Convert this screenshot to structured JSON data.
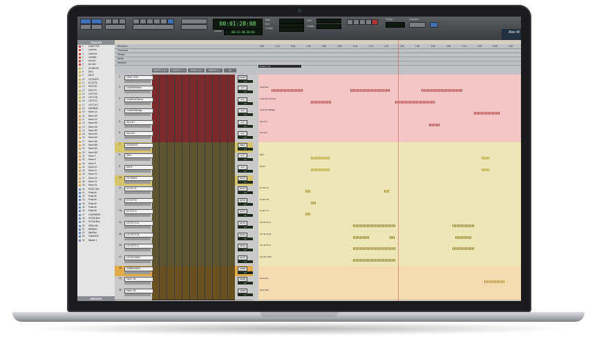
{
  "toolbar": {
    "main_counter": "00:01:28:08",
    "secondary_counter": "00:31:38:20:01",
    "start_label": "Start",
    "end_label": "End",
    "length_label": "Length",
    "nudge_label": "Nudge",
    "tempo_label": "Tempo",
    "quantize_label": "Quantize",
    "cursor_label": "Cursor",
    "grid_label": "Grid",
    "user_name": "Alex W"
  },
  "sidebar": {
    "tracks_header": "TRACKS",
    "groups_header": "GROUPS",
    "items": [
      {
        "num": "1",
        "name": "LEAD VOX",
        "color": "#d24040"
      },
      {
        "num": "2",
        "name": "LdVoVrs",
        "color": "#d24040"
      },
      {
        "num": "3",
        "name": "LdVoChr",
        "color": "#d24040"
      },
      {
        "num": "4",
        "name": "LdVdBri",
        "color": "#d24040"
      },
      {
        "num": "5",
        "name": "Ad Lib1",
        "color": "#d24040"
      },
      {
        "num": "6",
        "name": "Ad Lib2",
        "color": "#d24040"
      },
      {
        "num": "7",
        "name": "DOUBLES",
        "color": "#c8b442"
      },
      {
        "num": "8",
        "name": "Dbl L",
        "color": "#c8b442"
      },
      {
        "num": "9",
        "name": "Dbl R",
        "color": "#c8b442"
      },
      {
        "num": "10",
        "name": "OCTAVES",
        "color": "#c8b442"
      },
      {
        "num": "11",
        "name": "HI OCTA",
        "color": "#c8b442"
      },
      {
        "num": "12",
        "name": "HIOCTB",
        "color": "#c8b442"
      },
      {
        "num": "13",
        "name": "HIOCTC",
        "color": "#c8b442"
      },
      {
        "num": "14",
        "name": "LOCTVA",
        "color": "#c8b442"
      },
      {
        "num": "15",
        "name": "LOCTVB",
        "color": "#c8b442"
      },
      {
        "num": "16",
        "name": "LOCTVC",
        "color": "#c8b442"
      },
      {
        "num": "17",
        "name": "LOCTVLT",
        "color": "#c8b442"
      },
      {
        "num": "18",
        "name": "HARMNS",
        "color": "#e0a040"
      },
      {
        "num": "19",
        "name": "Harm 1A",
        "color": "#e0a040"
      },
      {
        "num": "20",
        "name": "Harm 1B",
        "color": "#e0a040"
      },
      {
        "num": "21",
        "name": "Harm 2A",
        "color": "#e0a040"
      },
      {
        "num": "22",
        "name": "Harm 2B",
        "color": "#e0a040"
      },
      {
        "num": "23",
        "name": "Harm 3A",
        "color": "#e0a040"
      },
      {
        "num": "24",
        "name": "Harm 3B",
        "color": "#e0a040"
      },
      {
        "num": "25",
        "name": "Harm 4A",
        "color": "#e0a040"
      },
      {
        "num": "26",
        "name": "Harm 4B",
        "color": "#e0a040"
      },
      {
        "num": "27",
        "name": "Harm 5A",
        "color": "#e0a040"
      },
      {
        "num": "28",
        "name": "Harm 5B",
        "color": "#e0a040"
      },
      {
        "num": "29",
        "name": "Harm 6A",
        "color": "#e0a040"
      },
      {
        "num": "30",
        "name": "Harm 6B",
        "color": "#e0a040"
      },
      {
        "num": "31",
        "name": "Harm 7",
        "color": "#e0a040"
      },
      {
        "num": "32",
        "name": "Harm 8",
        "color": "#e0a040"
      },
      {
        "num": "33",
        "name": "Harm 9",
        "color": "#e0a040"
      },
      {
        "num": "34",
        "name": "Harm 10",
        "color": "#e0a040"
      },
      {
        "num": "35",
        "name": "Harm 11",
        "color": "#e0a040"
      },
      {
        "num": "36",
        "name": "Harm 12",
        "color": "#e0a040"
      },
      {
        "num": "37",
        "name": "Harm 13",
        "color": "#e0a040"
      },
      {
        "num": "38",
        "name": "Harm 14",
        "color": "#e0a040"
      },
      {
        "num": "39",
        "name": "Harm 15",
        "color": "#e0a040"
      },
      {
        "num": "40",
        "name": "PDSTCHN",
        "color": "#6a8fc8"
      },
      {
        "num": "41",
        "name": "PostLdV",
        "color": "#6a8fc8"
      },
      {
        "num": "42",
        "name": "PostLdV",
        "color": "#6a8fc8"
      },
      {
        "num": "43",
        "name": "PostLdV",
        "color": "#6a8fc8"
      },
      {
        "num": "44",
        "name": "PostLdV",
        "color": "#6a8fc8"
      },
      {
        "num": "45",
        "name": "PostLdV",
        "color": "#6a8fc8"
      },
      {
        "num": "46",
        "name": "PostLdV",
        "color": "#6a8fc8"
      },
      {
        "num": "47",
        "name": "LOVEWIRE",
        "color": "#6a8fc8"
      },
      {
        "num": "48",
        "name": "VOCALBus",
        "color": "#6a8fc8"
      },
      {
        "num": "49",
        "name": "VOCALBus",
        "color": "#6a8fc8"
      },
      {
        "num": "50",
        "name": "MPAL040",
        "color": "#6a8fc8"
      },
      {
        "num": "51",
        "name": "MPAB00",
        "color": "#6a8fc8"
      },
      {
        "num": "52",
        "name": "MidiFilm",
        "color": "#6a8fc8"
      },
      {
        "num": "53",
        "name": "FAMASTE",
        "color": "#6a8fc8"
      },
      {
        "num": "54",
        "name": "Master 1",
        "color": "#6a8fc8"
      }
    ]
  },
  "rulers": {
    "rows": [
      "Min:Secs",
      "Timecode",
      "Tempo",
      "Meter",
      "Markers"
    ],
    "times": [
      "0:00",
      "0:10",
      "0:20",
      "0:30",
      "0:40",
      "0:50",
      "1:00",
      "1:10",
      "1:20",
      "1:30",
      "1:40",
      "1:50",
      "2:00",
      "2:10",
      "2:20",
      "2:30",
      "2:40"
    ],
    "default_label": "Default: 4/4",
    "column_headers": [
      "INSERTS A-E",
      "INSERTS F-J",
      "SENDS A-E",
      "SENDS F-J",
      "I/O"
    ]
  },
  "tracks": [
    {
      "num": "1",
      "name": "LEAD VOX",
      "io": "LEADV",
      "vol": "0.0",
      "type": "folder",
      "hdr_color": "#c9c9c9",
      "lane_color": "#f4c6c6",
      "ins_color": "#7a2a2a",
      "clip": "",
      "waves": []
    },
    {
      "num": "2",
      "name": "LeadVoxVerse",
      "io": "1-2",
      "vol": "0.0",
      "type": "audio",
      "hdr_color": "#c9c9c9",
      "lane_color": "#f4c6c6",
      "ins_color": "#7a2a2a",
      "clip": "Lead Vox",
      "waves": [
        {
          "start": 0.05,
          "width": 0.12,
          "color": "#b23838"
        },
        {
          "start": 0.35,
          "width": 0.15,
          "color": "#b23838"
        },
        {
          "start": 0.62,
          "width": 0.16,
          "color": "#b23838"
        }
      ]
    },
    {
      "num": "3",
      "name": "LeadVoxChorus",
      "io": "1-2",
      "vol": "0.0",
      "type": "audio",
      "hdr_color": "#c9c9c9",
      "lane_color": "#f4c6c6",
      "ins_color": "#7a2a2a",
      "clip": "Lead Vox Chorus",
      "waves": [
        {
          "start": 0.2,
          "width": 0.08,
          "color": "#b23838"
        },
        {
          "start": 0.52,
          "width": 0.15,
          "color": "#b23838"
        }
      ]
    },
    {
      "num": "4",
      "name": "LeadVoxBridge",
      "io": "1-2",
      "vol": "0.0",
      "type": "audio",
      "hdr_color": "#c9c9c9",
      "lane_color": "#f4c6c6",
      "ins_color": "#7a2a2a",
      "clip": "Lead Vox Bridge",
      "waves": [
        {
          "start": 0.82,
          "width": 0.1,
          "color": "#b23838"
        }
      ]
    },
    {
      "num": "5",
      "name": "Ad Lib 1",
      "io": "1-2",
      "vol": "0.0",
      "type": "audio",
      "hdr_color": "#c9c9c9",
      "lane_color": "#f4c6c6",
      "ins_color": "#7a2a2a",
      "clip": "Ad Lib 1",
      "waves": [
        {
          "start": 0.65,
          "width": 0.04,
          "color": "#b23838"
        }
      ]
    },
    {
      "num": "6",
      "name": "Ad Lib 2",
      "io": "1-2",
      "vol": "0.0",
      "type": "audio",
      "hdr_color": "#c9c9c9",
      "lane_color": "#f4c6c6",
      "ins_color": "#7a2a2a",
      "clip": "Ad Lib 2",
      "waves": []
    },
    {
      "num": "7",
      "name": "DOUBLES",
      "io": "DBLS",
      "vol": "0.0",
      "type": "folder",
      "hdr_color": "#d6c46a",
      "lane_color": "#efe6b8",
      "ins_color": "#5e5530",
      "clip": "",
      "waves": []
    },
    {
      "num": "8",
      "name": "Dbl L",
      "io": "1-2",
      "vol": "0.0",
      "type": "audio",
      "hdr_color": "#c9c9c9",
      "lane_color": "#efe6b8",
      "ins_color": "#5e5530",
      "clip": "Dbl L",
      "waves": [
        {
          "start": 0.2,
          "width": 0.07,
          "color": "#b09a2a"
        },
        {
          "start": 0.85,
          "width": 0.03,
          "color": "#b09a2a"
        }
      ]
    },
    {
      "num": "9",
      "name": "Dbl R",
      "io": "1-2",
      "vol": "0.0",
      "type": "audio",
      "hdr_color": "#c9c9c9",
      "lane_color": "#efe6b8",
      "ins_color": "#5e5530",
      "clip": "Dbl R",
      "waves": [
        {
          "start": 0.2,
          "width": 0.07,
          "color": "#b09a2a"
        },
        {
          "start": 0.85,
          "width": 0.03,
          "color": "#b09a2a"
        }
      ]
    },
    {
      "num": "10",
      "name": "OCTAVES",
      "io": "OCTV",
      "vol": "0.0",
      "type": "folder",
      "hdr_color": "#d6c46a",
      "lane_color": "#efe6b8",
      "ins_color": "#5e5530",
      "clip": "",
      "waves": []
    },
    {
      "num": "11",
      "name": "HI OCT A",
      "io": "OCTV",
      "vol": "0.0",
      "type": "audio",
      "hdr_color": "#c9c9c9",
      "lane_color": "#efe6b8",
      "ins_color": "#5e5530",
      "clip": "HI OCT A",
      "waves": [
        {
          "start": 0.18,
          "width": 0.02,
          "color": "#a08a20"
        },
        {
          "start": 0.48,
          "width": 0.02,
          "color": "#a08a20"
        }
      ]
    },
    {
      "num": "12",
      "name": "HI OCT B",
      "io": "OCTV",
      "vol": "0.0",
      "type": "audio",
      "hdr_color": "#c9c9c9",
      "lane_color": "#efe6b8",
      "ins_color": "#5e5530",
      "clip": "HI OCT B",
      "waves": [
        {
          "start": 0.2,
          "width": 0.02,
          "color": "#a08a20"
        }
      ]
    },
    {
      "num": "13",
      "name": "HI OCT C",
      "io": "OCTV",
      "vol": "0.0",
      "type": "audio",
      "hdr_color": "#c9c9c9",
      "lane_color": "#efe6b8",
      "ins_color": "#5e5530",
      "clip": "HI OCT C",
      "waves": [
        {
          "start": 0.18,
          "width": 0.02,
          "color": "#a08a20"
        }
      ]
    },
    {
      "num": "14",
      "name": "LO OCTV A",
      "io": "OCTV",
      "vol": "0.0",
      "type": "audio",
      "hdr_color": "#c9c9c9",
      "lane_color": "#efe6b8",
      "ins_color": "#5e5530",
      "clip": "LO OCTV A",
      "waves": [
        {
          "start": 0.36,
          "width": 0.16,
          "color": "#8a7a22"
        },
        {
          "start": 0.74,
          "width": 0.08,
          "color": "#8a7a22"
        }
      ]
    },
    {
      "num": "15",
      "name": "LO OCTV B",
      "io": "OCTV",
      "vol": "0.0",
      "type": "audio",
      "hdr_color": "#c9c9c9",
      "lane_color": "#efe6b8",
      "ins_color": "#5e5530",
      "clip": "LO OCTV B",
      "waves": [
        {
          "start": 0.36,
          "width": 0.06,
          "color": "#8a7a22"
        },
        {
          "start": 0.5,
          "width": 0.02,
          "color": "#8a7a22"
        },
        {
          "start": 0.75,
          "width": 0.06,
          "color": "#8a7a22"
        }
      ]
    },
    {
      "num": "16",
      "name": "LO OCTV C",
      "io": "OCTV",
      "vol": "0.0",
      "type": "audio",
      "hdr_color": "#c9c9c9",
      "lane_color": "#efe6b8",
      "ins_color": "#5e5530",
      "clip": "LO OCTV C",
      "waves": [
        {
          "start": 0.36,
          "width": 0.16,
          "color": "#8a7a22"
        },
        {
          "start": 0.74,
          "width": 0.08,
          "color": "#8a7a22"
        }
      ]
    },
    {
      "num": "17",
      "name": "LO OCTVALT",
      "io": "OCTV",
      "vol": "0.0",
      "type": "audio",
      "hdr_color": "#c9c9c9",
      "lane_color": "#efe6b8",
      "ins_color": "#5e5530",
      "clip": "LO OCT Alts",
      "waves": [
        {
          "start": 0.36,
          "width": 0.16,
          "color": "#8a7a22"
        }
      ]
    },
    {
      "num": "18",
      "name": "HARMONIES",
      "io": "HARM",
      "vol": "0.0",
      "type": "folder",
      "hdr_color": "#e3aa4a",
      "lane_color": "#f5dcb0",
      "ins_color": "#6a5020",
      "clip": "",
      "waves": []
    },
    {
      "num": "19",
      "name": "Harm 1A",
      "io": "HARM",
      "vol": "0.0",
      "type": "audio",
      "hdr_color": "#c9c9c9",
      "lane_color": "#f5dcb0",
      "ins_color": "#6a5020",
      "clip": "Harm 1A",
      "waves": [
        {
          "start": 0.86,
          "width": 0.08,
          "color": "#c08a28"
        }
      ]
    },
    {
      "num": "20",
      "name": "Harm 1B",
      "io": "HARM",
      "vol": "0.0",
      "type": "audio",
      "hdr_color": "#c9c9c9",
      "lane_color": "#f5dcb0",
      "ins_color": "#6a5020",
      "clip": "Harm 1B",
      "waves": []
    }
  ]
}
